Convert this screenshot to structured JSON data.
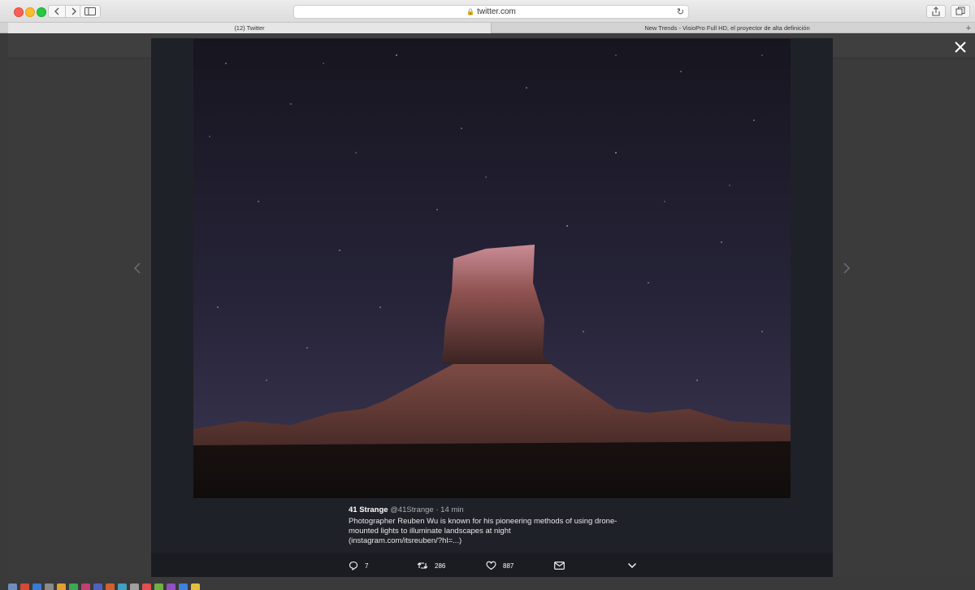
{
  "browser": {
    "url": "twitter.com",
    "tabs": [
      {
        "label": "(12) Twitter",
        "active": true
      },
      {
        "label": "New Trends - VisioPro Full HD, el proyector de alta definición",
        "active": false
      }
    ],
    "new_tab_label": "+"
  },
  "tweet": {
    "author_name": "41 Strange",
    "author_handle": "@41Strange",
    "separator": "·",
    "time": "14 min",
    "text": "Photographer Reuben Wu is known for his pioneering methods of using drone-mounted lights to illuminate landscapes at night",
    "link": "(instagram.com/itsreuben/?hl=...)"
  },
  "actions": {
    "reply_count": "7",
    "retweet_count": "286",
    "like_count": "887"
  },
  "icons": {
    "close": "close-icon",
    "prev": "chevron-left-icon",
    "next": "chevron-right-icon",
    "reply": "reply-icon",
    "retweet": "retweet-icon",
    "like": "heart-icon",
    "dm": "envelope-icon",
    "more": "chevron-down-icon"
  },
  "colors": {
    "modal_bg": "#1f2128",
    "page_bg": "#3a3a3a",
    "text": "#ffffff"
  }
}
